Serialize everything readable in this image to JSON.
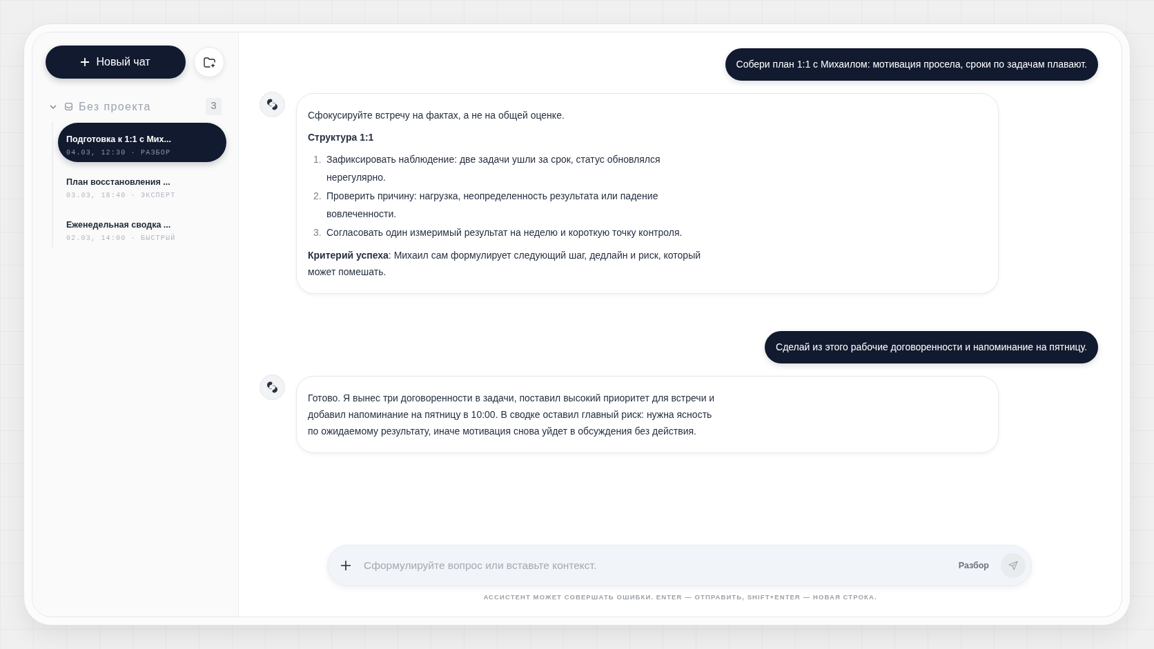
{
  "sidebar": {
    "new_chat_button": {
      "label": "Новый чат"
    },
    "groups": [
      {
        "title": "Без проекта",
        "count": "3",
        "expanded": true,
        "chats": [
          {
            "title": "Подготовка к 1:1 с Мих...",
            "meta": "04.03, 12:30 · РАЗБОР",
            "selected": true
          },
          {
            "title": "План восстановления ...",
            "meta": "03.03, 18:40 · ЭКСПЕРТ",
            "selected": false
          },
          {
            "title": "Еженедельная сводка ...",
            "meta": "02.03, 14:00 · БЫСТРЫЙ",
            "selected": false
          }
        ]
      }
    ]
  },
  "messages": [
    {
      "kind": "user",
      "text": "Собери план 1:1 с Михаилом: мотивация просела, сроки по задачам плавают."
    },
    {
      "kind": "assistant",
      "blocks": [
        {
          "kind": "paragraph",
          "text": "Сфокусируйте встречу на фактах, а не на общей оценке."
        },
        {
          "kind": "heading",
          "text": "Структура 1:1"
        },
        {
          "kind": "list",
          "items": [
            {
              "number": "1.",
              "text": "Зафиксировать наблюдение: две задачи ушли за срок, статус обновлялся нерегулярно."
            },
            {
              "number": "2.",
              "text": "Проверить причину: нагрузка, неопределенность результата или падение вовлеченности."
            },
            {
              "number": "3.",
              "text": "Согласовать один измеримый результат на неделю и короткую точку контроля."
            }
          ]
        },
        {
          "kind": "paragraph",
          "text": "**Критерий успеха**: Михаил сам формулирует следующий шаг, дедлайн и риск, который может помешать."
        }
      ]
    },
    {
      "kind": "user",
      "text": "Сделай из этого рабочие договоренности и напоминание на пятницу."
    },
    {
      "kind": "assistant",
      "blocks": [
        {
          "kind": "paragraph",
          "text": "Готово. Я вынес три договоренности в задачи, поставил высокий приоритет для встречи и добавил напоминание на пятницу в 10:00. В сводке оставил главный риск: нужна ясность по ожидаемому результату, иначе мотивация снова уйдет в обсуждения без действия."
        }
      ]
    }
  ],
  "composer": {
    "placeholder": "Сформулируйте вопрос или вставьте контекст.",
    "mode": "Разбор",
    "send_button": {
      "disabled": true
    }
  },
  "footer_note": "АССИСТЕНТ МОЖЕТ СОВЕРШАТЬ ОШИБКИ. ENTER — ОТПРАВИТЬ, SHIFT+ENTER — НОВАЯ СТРОКА."
}
